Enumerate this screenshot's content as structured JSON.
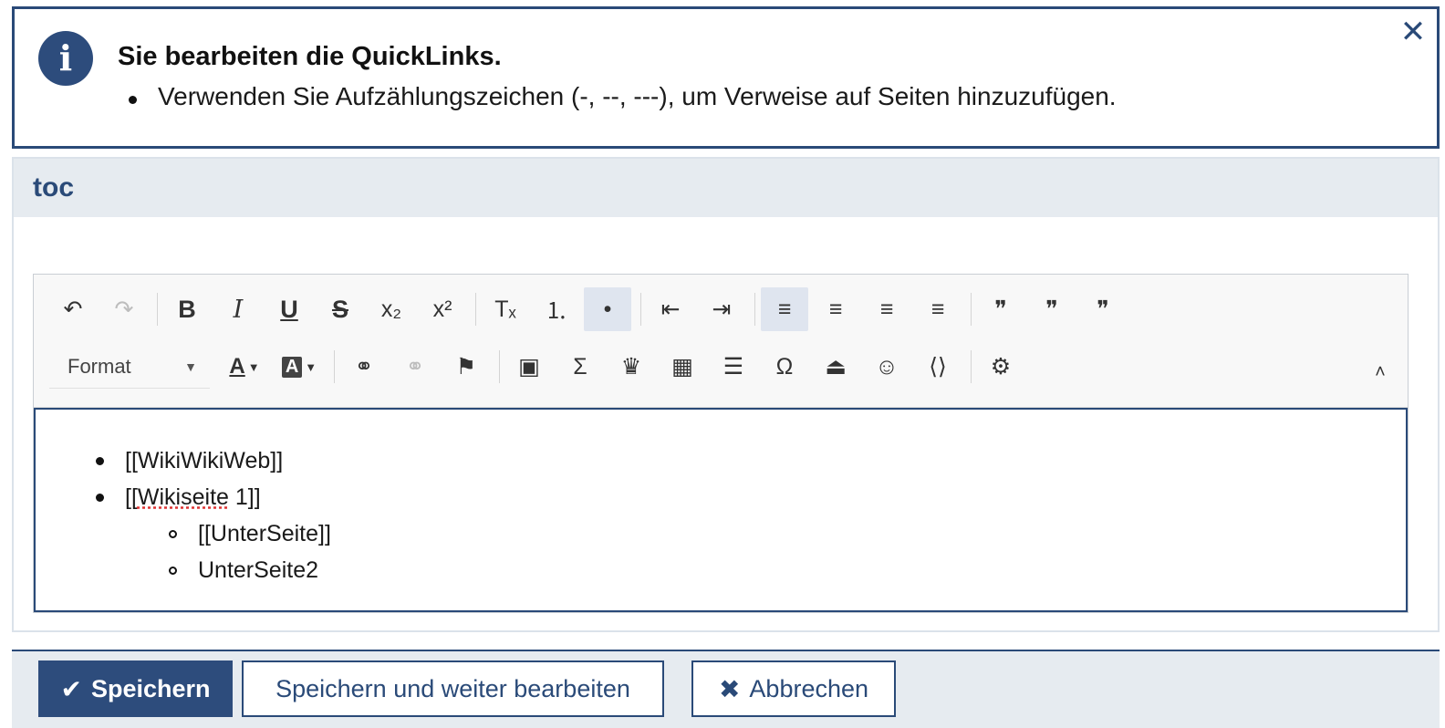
{
  "notice": {
    "title": "Sie bearbeiten die QuickLinks.",
    "items": [
      "Verwenden Sie Aufzählungszeichen (-, --, ---), um Verweise auf Seiten hinzuzufügen."
    ],
    "info_icon": "i",
    "close_icon": "✕"
  },
  "panel": {
    "title": "toc"
  },
  "toolbar": {
    "format_label": "Format",
    "buttons": {
      "undo": "↶",
      "redo": "↷",
      "bold": "B",
      "italic": "I",
      "underline": "U",
      "strike": "S",
      "subscript": "x₂",
      "superscript": "x²",
      "remove_format": "Tₓ",
      "numbered_list": "⒈",
      "bulleted_list": "•",
      "outdent": "⇤",
      "indent": "⇥",
      "align_left": "≡",
      "align_center": "≡",
      "align_right": "≡",
      "justify": "≡",
      "blockquote": "❞",
      "blockquote_split": "❞",
      "blockquote_remove": "❞",
      "text_color": "A",
      "bg_color": "A",
      "link": "⚭",
      "unlink": "⚭",
      "anchor": "⚑",
      "image": "▣",
      "math": "Σ",
      "special": "♛",
      "table": "▦",
      "hr": "☰",
      "omega": "Ω",
      "eject": "⏏",
      "smiley": "☺",
      "source": "⟨⟩",
      "plugin": "⚙",
      "collapse": "˄"
    }
  },
  "content": {
    "items": [
      {
        "text": "[[WikiWikiWeb]]"
      },
      {
        "text_prefix": "[[",
        "text_spell": "Wikiseite",
        "text_suffix": " 1]]"
      }
    ],
    "subitems": [
      "[[UnterSeite]]",
      "UnterSeite2"
    ]
  },
  "footer": {
    "save_label": "Speichern",
    "save_continue_label": "Speichern und weiter bearbeiten",
    "cancel_label": "Abbrechen",
    "save_icon": "✔",
    "cancel_icon": "✖"
  },
  "colors": {
    "accent": "#2d4c7c",
    "panel_bg": "#e6ebf0",
    "active_button": "#dfe5ef"
  }
}
